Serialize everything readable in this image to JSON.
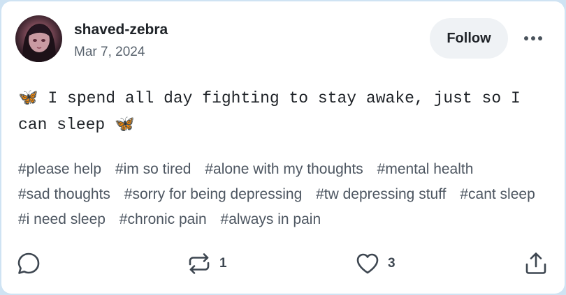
{
  "post": {
    "author": {
      "username": "shaved-zebra",
      "date": "Mar 7, 2024"
    },
    "follow_label": "Follow",
    "more_icon": "ellipsis-icon",
    "text": "🦋 I spend all day fighting to stay awake, just so I can sleep 🦋",
    "tags": [
      "#please help",
      "#im so tired",
      "#alone with my thoughts",
      "#mental health",
      "#sad thoughts",
      "#sorry for being depressing",
      "#tw depressing stuff",
      "#cant sleep",
      "#i need sleep",
      "#chronic pain",
      "#always in pain"
    ],
    "actions": {
      "reply_icon": "comment-icon",
      "repost_icon": "repost-icon",
      "repost_count": "1",
      "like_icon": "heart-icon",
      "like_count": "3",
      "share_icon": "share-icon"
    }
  },
  "colors": {
    "background": "#cfe3f3",
    "card": "#ffffff",
    "follow_button": "#eff2f5",
    "text": "#1f2328",
    "muted": "#59636e"
  }
}
